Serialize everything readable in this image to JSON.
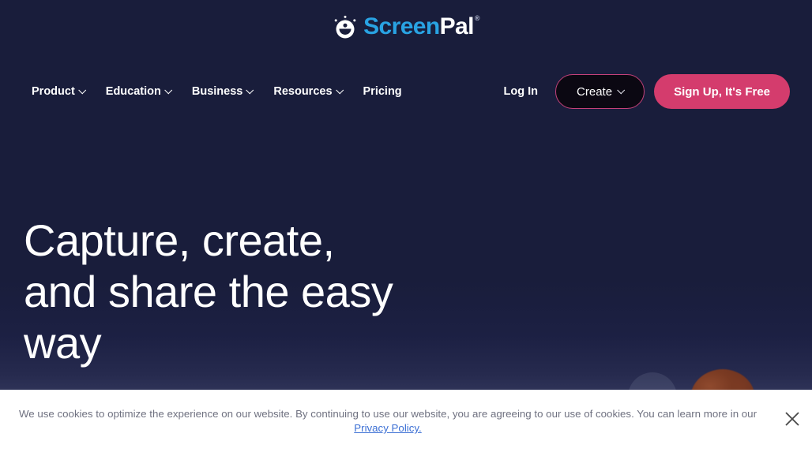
{
  "brand": {
    "logo_icon": "screenpal-smiley-icon",
    "name_part1": "Screen",
    "name_part2": "Pal",
    "registered_mark": "®",
    "blue": "#29a3e3",
    "pink": "#d43c6d",
    "navy": "#191d3b"
  },
  "nav": {
    "items": [
      {
        "label": "Product",
        "has_caret": true
      },
      {
        "label": "Education",
        "has_caret": true
      },
      {
        "label": "Business",
        "has_caret": true
      },
      {
        "label": "Resources",
        "has_caret": true
      },
      {
        "label": "Pricing",
        "has_caret": false
      }
    ],
    "login_label": "Log In",
    "create_label": "Create",
    "signup_label": "Sign Up, It's Free"
  },
  "hero": {
    "headline_line1": "Capture, create,",
    "headline_line2": "and share the easy",
    "headline_line3": "way"
  },
  "cookie": {
    "message": "We use cookies to optimize the experience on our website. By continuing to use our website, you are agreeing to our use of cookies. You can learn more in our",
    "link_label": "Privacy Policy.",
    "close_icon": "close-icon"
  }
}
